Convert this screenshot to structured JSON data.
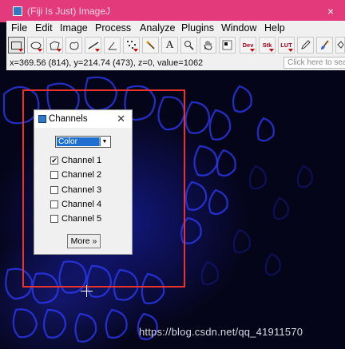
{
  "window": {
    "title": "(Fiji Is Just) ImageJ",
    "close_glyph": "×"
  },
  "menu": [
    "File",
    "Edit",
    "Image",
    "Process",
    "Analyze",
    "Plugins",
    "Window",
    "Help"
  ],
  "toolbar": {
    "dev_label": "Dev",
    "stk_label": "Stk",
    "lut_label": "LUT",
    "text_tool_glyph": "A"
  },
  "status": {
    "text": "x=369.56 (814), y=214.74 (473), z=0, value=1062",
    "search_placeholder": "Click here to search"
  },
  "dialog": {
    "title": "Channels",
    "close_glyph": "✕",
    "mode_value": "Color",
    "channels": [
      {
        "label": "Channel 1",
        "checked": true
      },
      {
        "label": "Channel 2",
        "checked": false
      },
      {
        "label": "Channel 3",
        "checked": false
      },
      {
        "label": "Channel 4",
        "checked": false
      },
      {
        "label": "Channel 5",
        "checked": false
      }
    ],
    "more_button": "More »"
  },
  "watermark": "https://blog.csdn.net/qq_41911570",
  "colors": {
    "titlebar": "#e23a7a",
    "highlight": "#e8322a",
    "image_blue": "#1e28d2"
  }
}
